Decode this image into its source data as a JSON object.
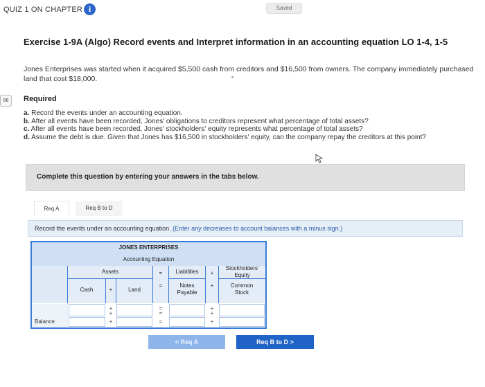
{
  "topbar": {
    "quiz_title": "QUIZ 1 ON CHAPTER 1",
    "info_glyph": "i",
    "saved_label": "Saved",
    "side_badge": "56"
  },
  "exercise": {
    "title": "Exercise 1-9A (Algo) Record events and Interpret information in an accounting equation LO 1-4, 1-5",
    "intro": "Jones Enterprises was started when it acquired $5,500 cash from creditors and $16,500 from owners. The company immediately purchased land that cost $18,000.",
    "required_heading": "Required",
    "requirements": [
      {
        "letter": "a.",
        "text": " Record the events under an accounting equation."
      },
      {
        "letter": "b.",
        "text": " After all events have been recorded, Jones' obligations to creditors represent what percentage of total assets?"
      },
      {
        "letter": "c.",
        "text": " After all events have been recorded, Jones' stockholders' equity represents what percentage of total assets?"
      },
      {
        "letter": "d.",
        "text": " Assume the debt is due. Given that Jones has $16,500 in stockholders' equity, can the company repay the creditors at this point?"
      }
    ]
  },
  "instructions": "Complete this question by entering your answers in the tabs below.",
  "tabs": [
    {
      "label": "Req A"
    },
    {
      "label": "Req B to D"
    }
  ],
  "task": {
    "main": "Record the events under an accounting equation.",
    "hint": " (Enter any decreases to account balances with a minus sign.)"
  },
  "table": {
    "company": "JONES ENTERPRISES",
    "subtitle": "Accounting Equation",
    "assets_label": "Assets",
    "equals": "=",
    "plus": "+",
    "liabilities_label": "Liabilities",
    "equity_label": "Stockholders' Equity",
    "col_cash": "Cash",
    "col_land": "Land",
    "col_notes": "Notes Payable",
    "col_stock": "Common Stock",
    "rows": [
      {
        "label": "",
        "cash": "",
        "land": "",
        "notes": "",
        "stock": ""
      },
      {
        "label": "",
        "cash": "",
        "land": "",
        "notes": "",
        "stock": ""
      },
      {
        "label": "Balance",
        "cash": "",
        "land": "",
        "notes": "",
        "stock": ""
      }
    ]
  },
  "nav": {
    "prev_label": "< Req A",
    "next_label": "Req B to D >"
  },
  "colors": {
    "accent": "#1f63c7",
    "table_border": "#3a7ad6",
    "header_fill": "#cfe0f5",
    "info_icon": "#2c66c9"
  }
}
